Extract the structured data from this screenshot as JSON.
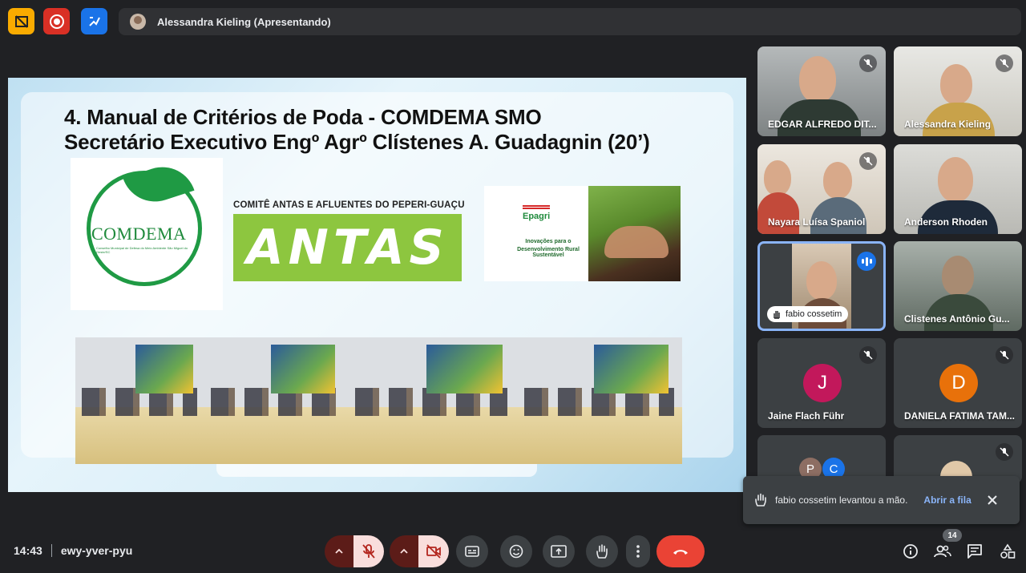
{
  "presenting": {
    "text": "Alessandra Kieling (Apresentando)"
  },
  "slide": {
    "title_line1": "4. Manual de Critérios de Poda - COMDEMA SMO",
    "title_line2": "Secretário Executivo Engº Agrº Clístenes A. Guadagnin (20’)",
    "comdema_text": "COMDEMA",
    "comdema_sub": "Conselho Municipal de Defesa do Meio Ambiente São Miguel do Oeste/SC",
    "antas_header": "COMITÊ ANTAS E AFLUENTES DO PEPERI-GUAÇU",
    "antas_word": "ANTAS",
    "epagri_logo": "Epagri",
    "epagri_line1": "Inovações para o",
    "epagri_line2": "Desenvolvimento Rural Sustentável"
  },
  "participants": [
    {
      "name": "EDGAR ALFREDO DIT...",
      "muted": true
    },
    {
      "name": "Alessandra Kieling",
      "muted": true
    },
    {
      "name": "Nayara Luísa Spaniol",
      "muted": true
    },
    {
      "name": "Anderson Rhoden",
      "muted": false
    },
    {
      "name": "fabio cossetim",
      "speaking": true,
      "hand_raised": true
    },
    {
      "name": "Clistenes Antônio Gu...",
      "muted": false
    },
    {
      "name": "Jaine Flach Führ",
      "initial": "J",
      "color": "#c2185b",
      "muted": true
    },
    {
      "name": "DANIELA FATIMA TAM...",
      "initial": "D",
      "color": "#e8710a",
      "muted": true
    },
    {
      "initials": [
        "P",
        "C"
      ],
      "colors": [
        "#8d6e63",
        "#1a73e8"
      ]
    }
  ],
  "toast": {
    "text": "fabio cossetim levantou a mão.",
    "link": "Abrir a fila"
  },
  "meeting": {
    "time": "14:43",
    "code": "ewy-yver-pyu",
    "participant_count": "14"
  },
  "icons": {
    "top": [
      "no-captions-icon",
      "record-icon",
      "whiteboard-icon"
    ],
    "controls": [
      "chevron-up-icon",
      "mic-off-icon",
      "chevron-up-icon",
      "camera-off-icon",
      "captions-icon",
      "emoji-icon",
      "present-icon",
      "raise-hand-icon",
      "more-icon",
      "end-call-icon"
    ],
    "right": [
      "info-icon",
      "people-icon",
      "chat-icon",
      "activities-icon"
    ]
  },
  "colors": {
    "background": "#202124",
    "end_call": "#ea4335",
    "speaking": "#1a73e8",
    "link": "#8ab4f8"
  }
}
